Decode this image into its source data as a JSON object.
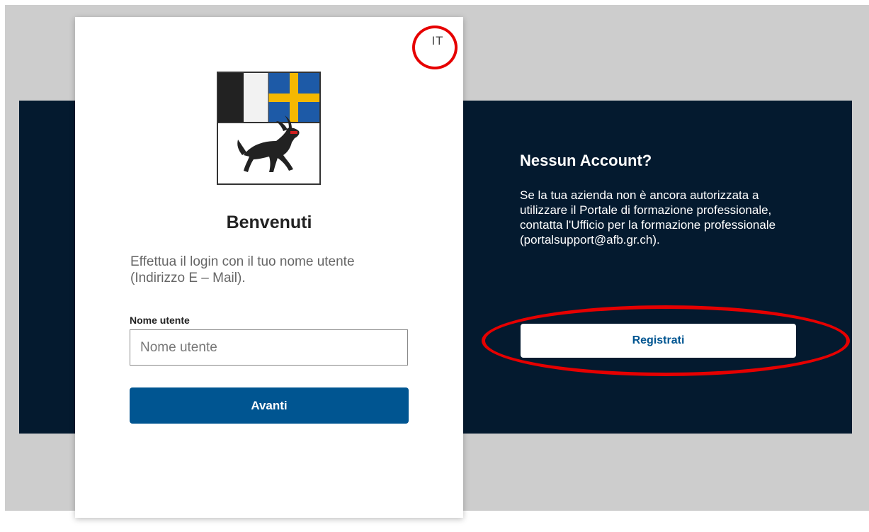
{
  "login": {
    "language": "IT",
    "welcome_title": "Benvenuti",
    "subtitle": "Effettua il login con il tuo nome utente (Indirizzo E – Mail).",
    "username_label": "Nome utente",
    "username_placeholder": "Nome utente",
    "username_value": "",
    "next_button": "Avanti",
    "emblem_icon": "coat-of-arms-icon"
  },
  "register": {
    "heading": "Nessun Account?",
    "text": "Se la tua azienda non è ancora autorizzata a utilizzare il Portale di formazione professionale, contatta l'Ufficio per la formazione professionale (portalsupport@afb.gr.ch).",
    "button": "Registrati"
  },
  "colors": {
    "dark_band": "#041a2f",
    "primary_blue": "#005591",
    "annotation_red": "#e60000",
    "page_grey": "#cdcdcd"
  }
}
